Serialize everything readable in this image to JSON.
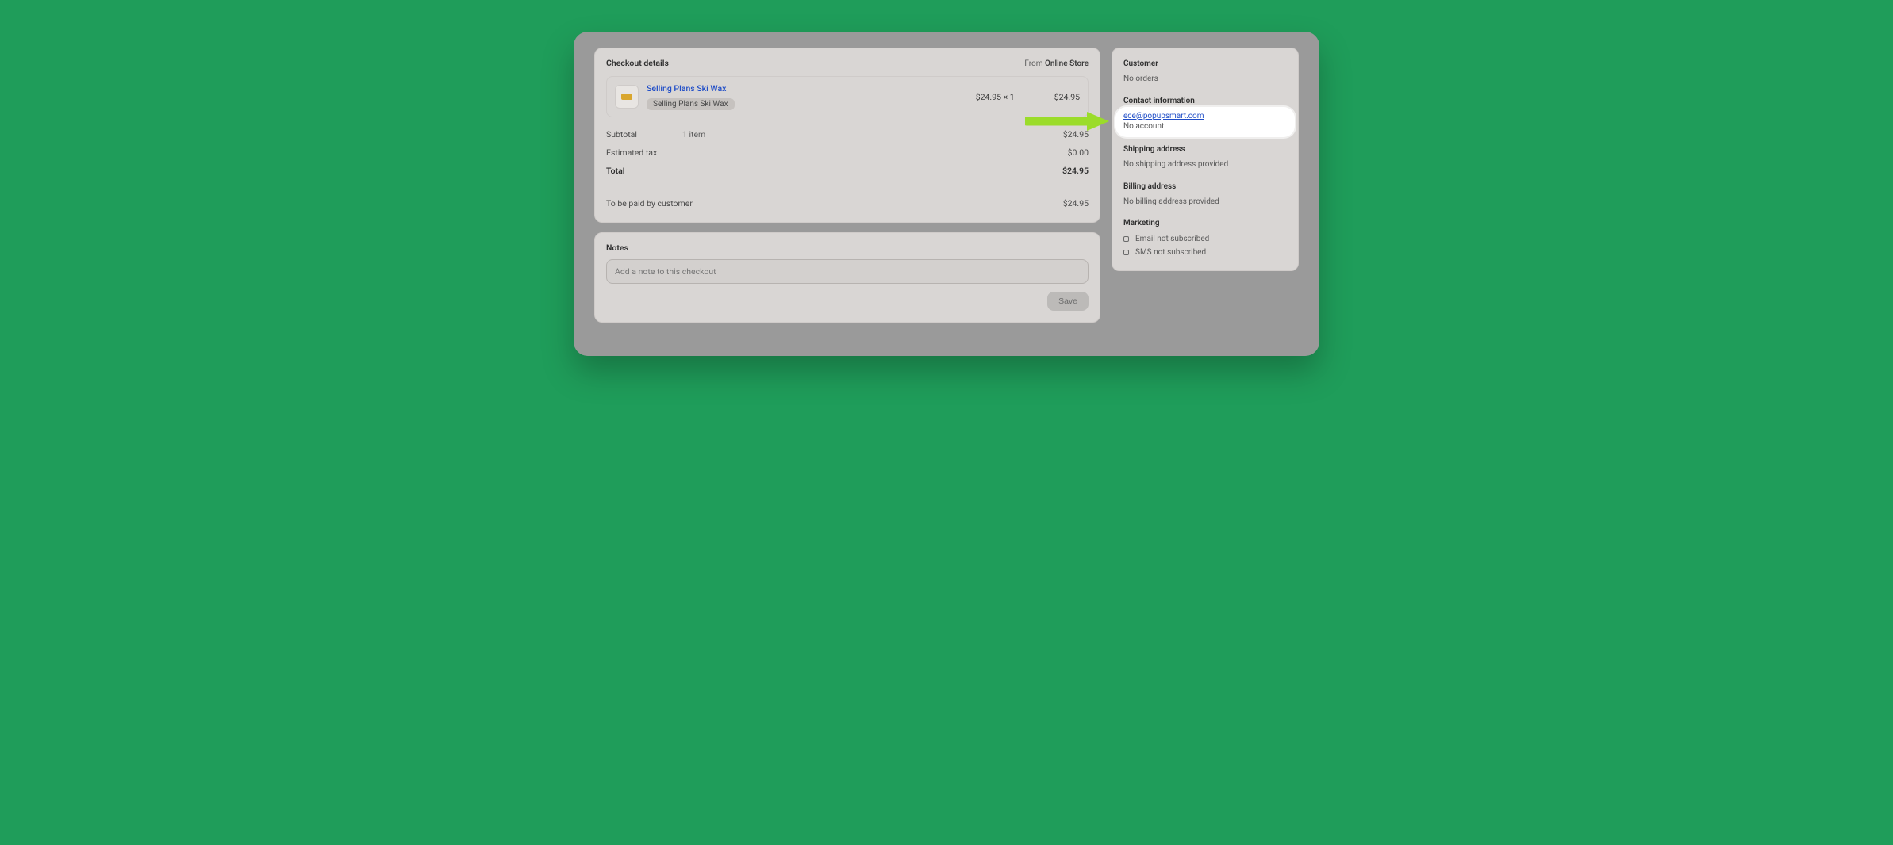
{
  "checkout": {
    "title": "Checkout details",
    "from_label": "From",
    "from_source": "Online Store",
    "product": {
      "name": "Selling Plans Ski Wax",
      "variant": "Selling Plans Ski Wax",
      "unit_price_display": "$24.95 × 1",
      "line_total": "$24.95"
    },
    "summary": {
      "subtotal_label": "Subtotal",
      "subtotal_detail": "1 item",
      "subtotal_amount": "$24.95",
      "tax_label": "Estimated tax",
      "tax_amount": "$0.00",
      "total_label": "Total",
      "total_amount": "$24.95",
      "to_be_paid_label": "To be paid by customer",
      "to_be_paid_amount": "$24.95"
    }
  },
  "notes": {
    "title": "Notes",
    "placeholder": "Add a note to this checkout",
    "save_label": "Save"
  },
  "sidebar": {
    "customer_heading": "Customer",
    "customer_orders": "No orders",
    "contact_heading": "Contact information",
    "email": "ece@popupsmart.com",
    "account_status": "No account",
    "shipping_heading": "Shipping address",
    "shipping_text": "No shipping address provided",
    "billing_heading": "Billing address",
    "billing_text": "No billing address provided",
    "marketing_heading": "Marketing",
    "marketing_email": "Email not subscribed",
    "marketing_sms": "SMS not subscribed"
  }
}
